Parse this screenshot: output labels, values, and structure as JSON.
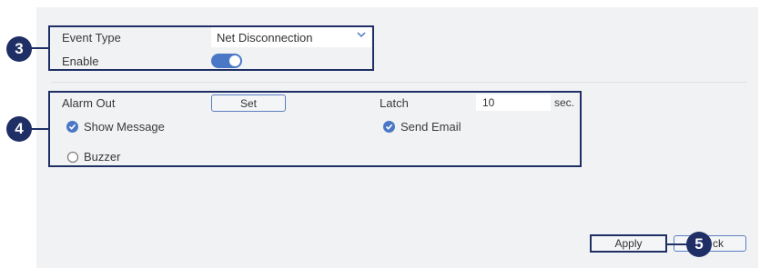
{
  "event": {
    "event_type_label": "Event Type",
    "event_type_value": "Net Disconnection",
    "enable_label": "Enable",
    "enable_on": true
  },
  "alarm": {
    "alarm_out_label": "Alarm Out",
    "set_label": "Set",
    "latch_label": "Latch",
    "latch_value": "10",
    "latch_unit": "sec.",
    "show_message_label": "Show Message",
    "show_message_checked": true,
    "send_email_label": "Send Email",
    "send_email_checked": true,
    "buzzer_label": "Buzzer",
    "buzzer_checked": false
  },
  "footer": {
    "apply_label": "Apply",
    "back_label_visible": "ck"
  },
  "callouts": {
    "c3": "3",
    "c4": "4",
    "c5": "5"
  },
  "colors": {
    "accent": "#4a78c6",
    "callout": "#1f2f66",
    "panel": "#f1f2f4"
  }
}
